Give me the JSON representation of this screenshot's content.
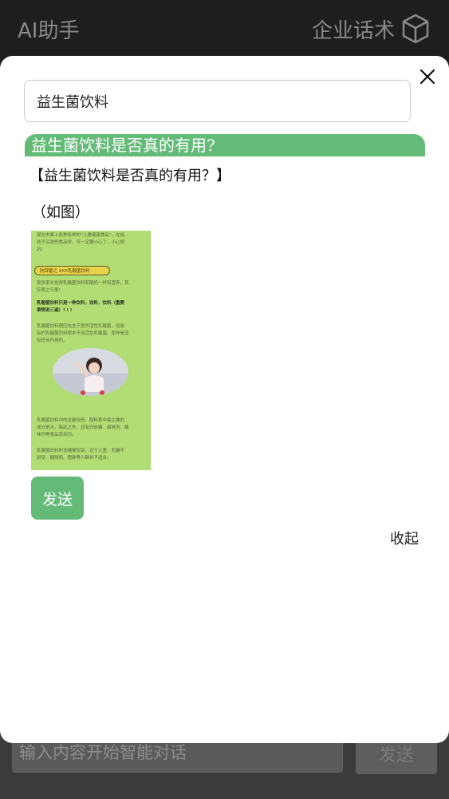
{
  "header": {
    "app_title": "AI助手",
    "scripts_label": "企业话术",
    "scripts_icon": "cube-icon"
  },
  "modal": {
    "search_value": "益生菌饮料",
    "result_title": "益生菌饮料是否真的有用?",
    "result_heading": "【益生菌饮料是否真的有用？】",
    "result_note": "（如图）",
    "poster": {
      "line1": "现在市面上各种各样的“儿童健康食品”，在给",
      "line2": "孩子买这些食品时，可一定要小心了，小心掉",
      "line3": "坑!",
      "pill": "防踩雷之 XXX乳酸菌饮料",
      "line4": "很多家长觉得乳酸菌饮料和酸奶一样有营养，其",
      "line5": "实差之千里!",
      "line6": "乳酸菌饮料只是一种饮料，饮料，饮料（重要",
      "line7": "事情说三遍）! ! !",
      "line8": "乳酸菌饮料理应包含于提供活性乳酸菌，但是",
      "line9": "有的乳酸菌饮料根本不含活性乳酸菌，那样是没",
      "line10": "有任何作用的。",
      "line11": "乳酸菌饮料中的含量较低，配料表中最主要的",
      "line12": "成分是水，除此之外，还有白砂糖、甜味剂、酸",
      "line13": "味剂等食品添加剂。",
      "line14": "乳酸菌饮料的含糖量较高，对于儿童、乳糖不",
      "line15": "耐受、糖尿病、肥胖等人群并不适合。"
    },
    "send_label": "发送",
    "collapse_label": "收起"
  },
  "footer": {
    "input_placeholder": "输入内容开始智能对话",
    "send_label": "发送"
  },
  "colors": {
    "accent": "#64bb78",
    "poster_bg": "#b2dc74",
    "topbar": "#1e1e1e"
  }
}
